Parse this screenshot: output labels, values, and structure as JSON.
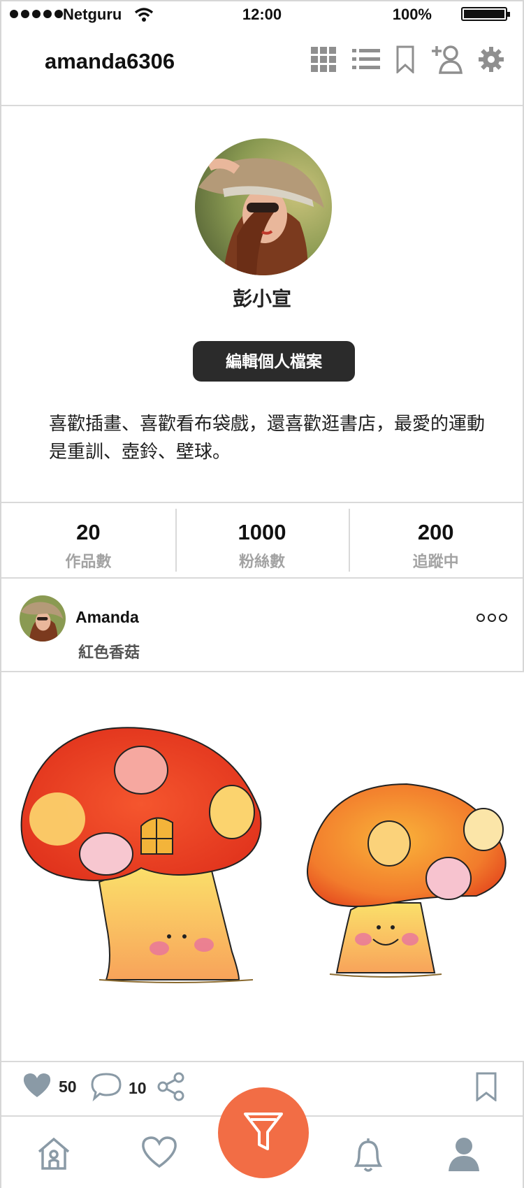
{
  "status_bar": {
    "carrier": "Netguru",
    "time": "12:00",
    "battery": "100%"
  },
  "header": {
    "username": "amanda6306",
    "icons": [
      "grid-icon",
      "list-icon",
      "bookmark-icon",
      "add-user-icon",
      "gear-icon"
    ]
  },
  "profile": {
    "display_name": "彭小宣",
    "edit_button": "編輯個人檔案",
    "bio": "喜歡插畫、喜歡看布袋戲，還喜歡逛書店，最愛的運動是重訓、壺鈴、壁球。"
  },
  "stats": [
    {
      "value": "20",
      "label": "作品數"
    },
    {
      "value": "1000",
      "label": "粉絲數"
    },
    {
      "value": "200",
      "label": "追蹤中"
    }
  ],
  "post": {
    "author": "Amanda",
    "title": "紅色香菇",
    "likes": "50",
    "comments": "10",
    "image_desc_icon": "mushroom-illustration"
  },
  "tabbar": {
    "icons": [
      "home-icon",
      "heart-icon",
      "filter-icon",
      "bell-icon",
      "profile-icon"
    ],
    "accent": "#f26d45"
  }
}
